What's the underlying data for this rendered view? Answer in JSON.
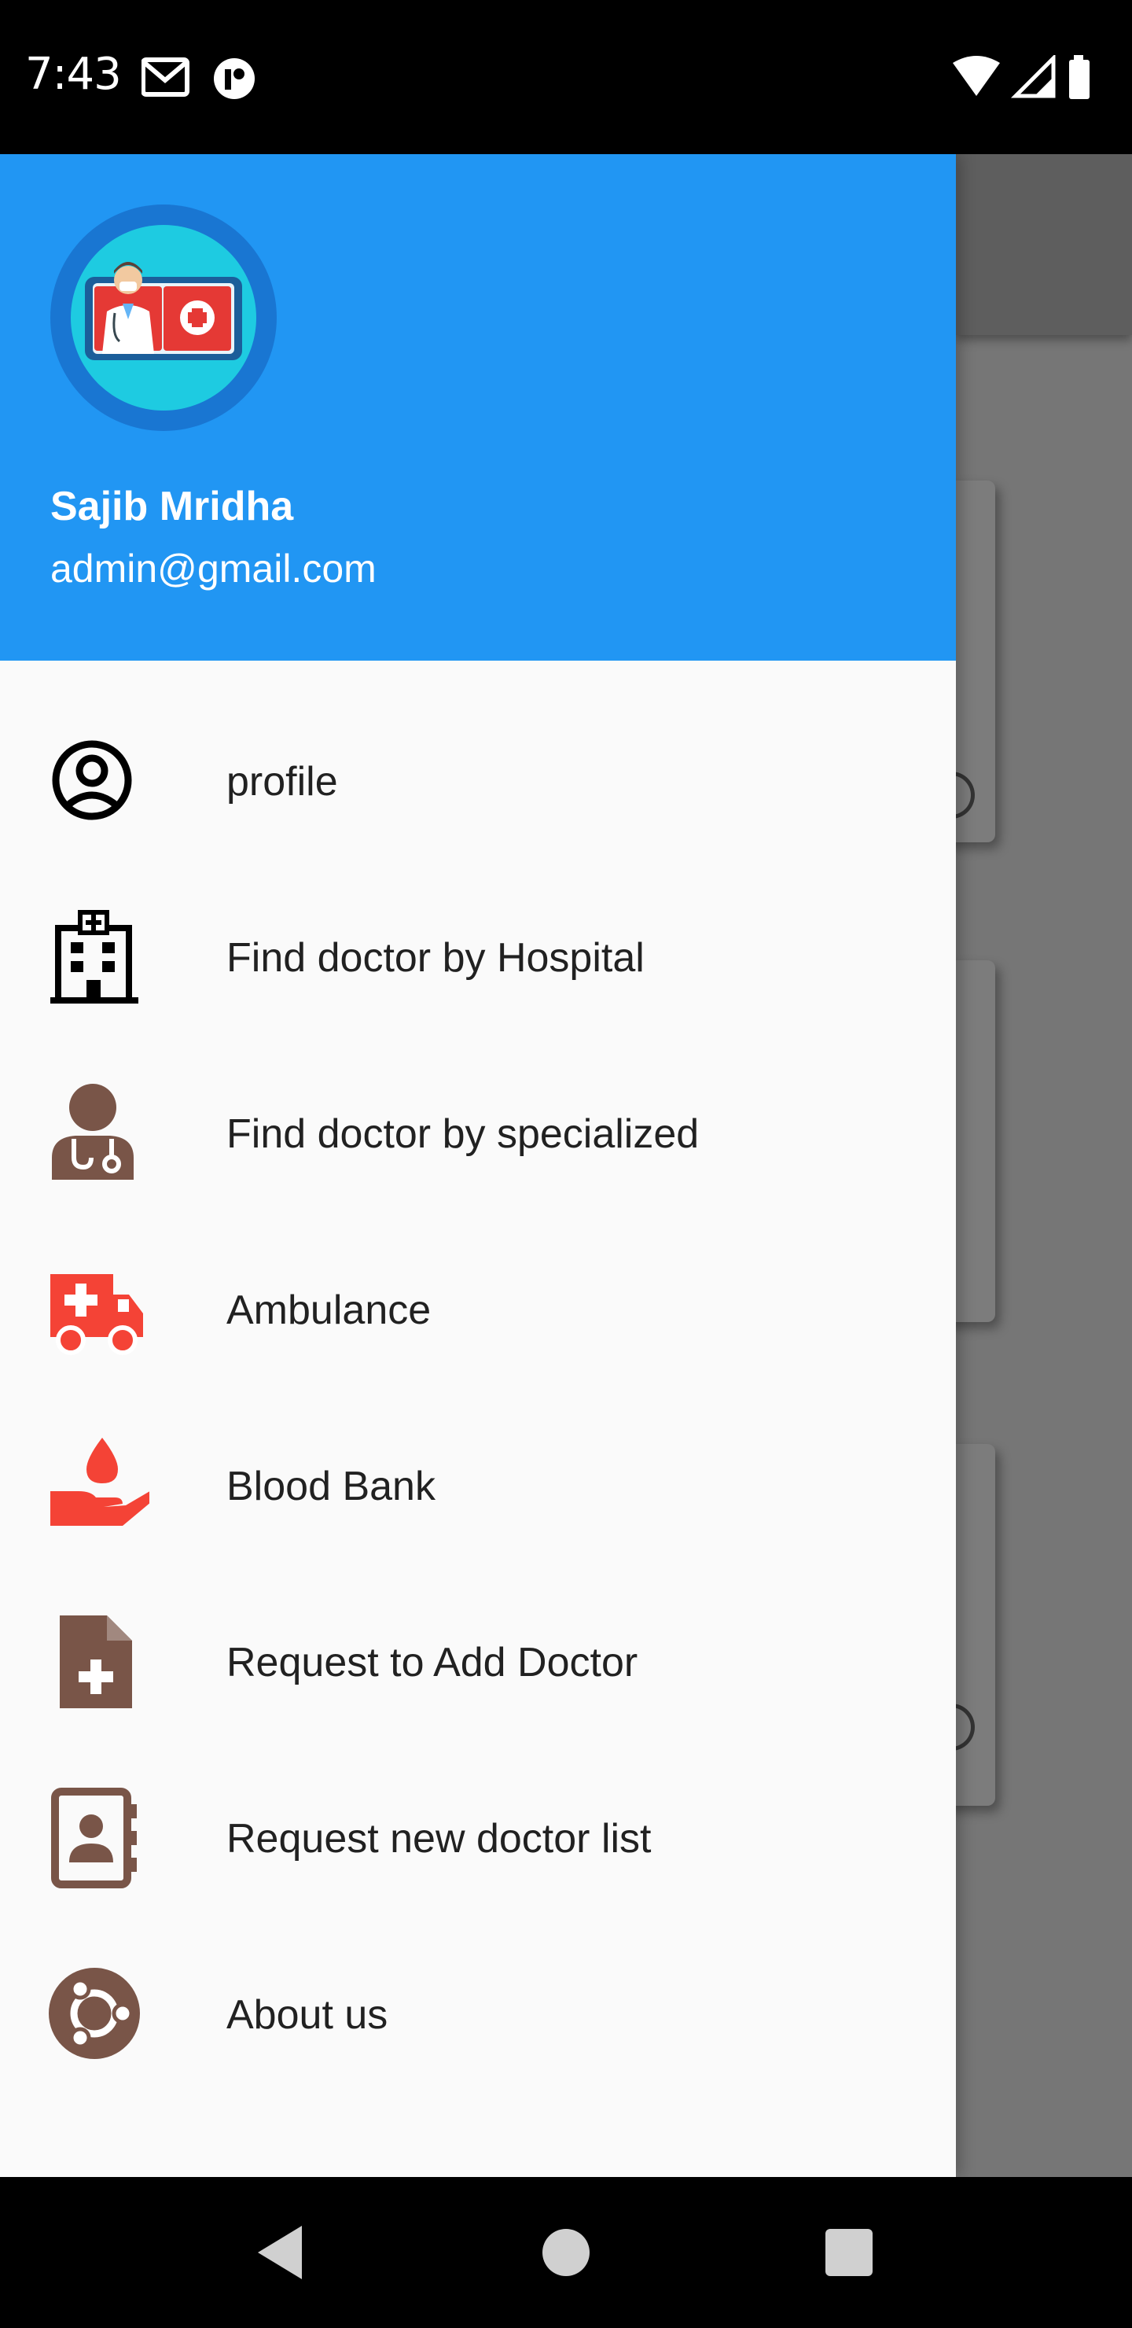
{
  "status_bar": {
    "time": "7:43",
    "left_icons": [
      "gmail-icon",
      "app-notification-icon"
    ],
    "right_icons": [
      "wifi-icon",
      "cell-signal-icon",
      "battery-icon"
    ]
  },
  "drawer": {
    "header": {
      "avatar": "doctor-app-logo",
      "user_name": "Sajib Mridha",
      "user_email": "admin@gmail.com",
      "background_color": "#2196f3"
    },
    "items": [
      {
        "label": "profile",
        "icon": "account-circle-icon"
      },
      {
        "label": "Find doctor by Hospital",
        "icon": "hospital-icon"
      },
      {
        "label": "Find doctor by specialized",
        "icon": "doctor-icon"
      },
      {
        "label": "Ambulance",
        "icon": "ambulance-icon"
      },
      {
        "label": "Blood Bank",
        "icon": "blood-donation-icon"
      },
      {
        "label": "Request to Add Doctor",
        "icon": "medical-file-icon"
      },
      {
        "label": "Request new doctor list",
        "icon": "contact-book-icon"
      },
      {
        "label": "About us",
        "icon": "about-ubuntu-icon"
      }
    ],
    "icon_colors": {
      "brown": "#795548",
      "red": "#f44336",
      "black": "#000000"
    }
  },
  "nav_bar": {
    "buttons": [
      "back-icon",
      "home-icon",
      "recents-icon"
    ]
  }
}
